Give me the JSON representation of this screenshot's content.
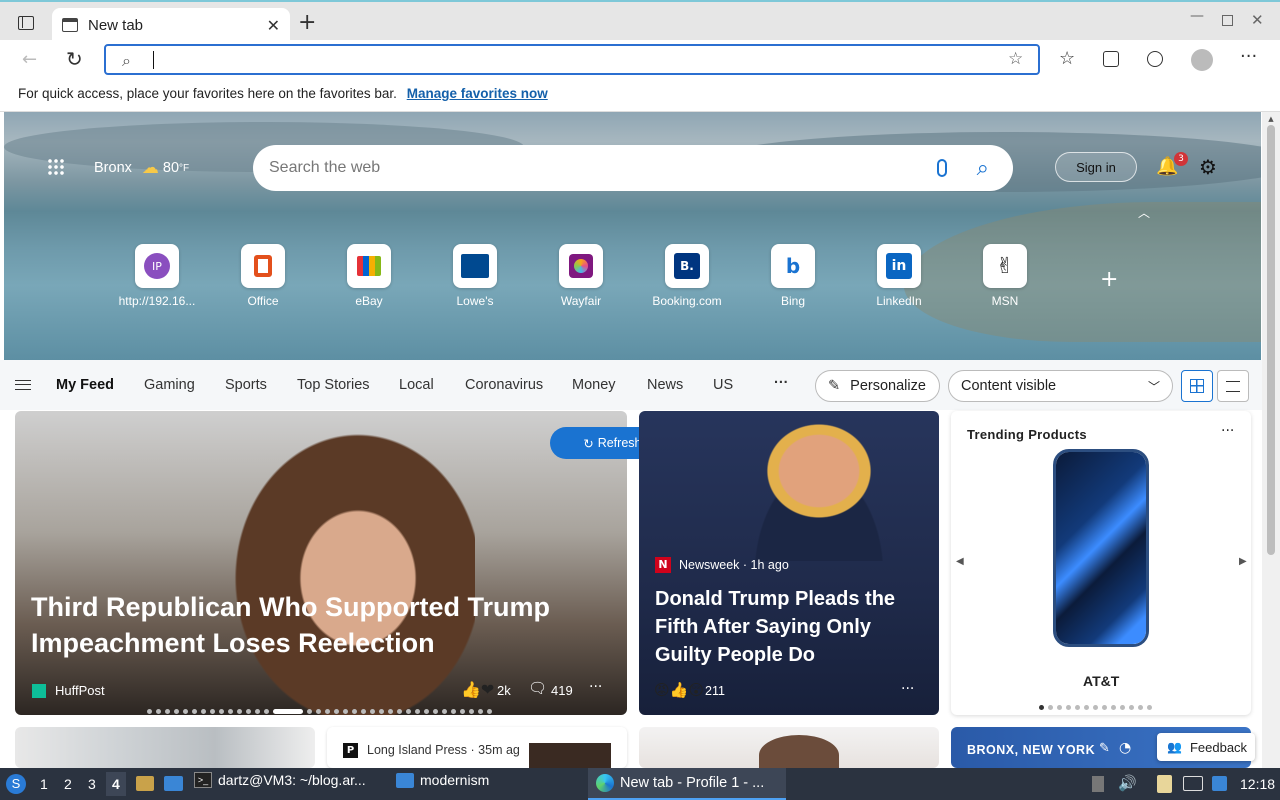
{
  "browser": {
    "tab_title": "New tab",
    "address_value": "",
    "favbar_text": "For quick access, place your favorites here on the favorites bar.",
    "favbar_link": "Manage favorites now"
  },
  "hero": {
    "location": "Bronx",
    "temp": "80",
    "unit": "°F",
    "search_placeholder": "Search the web",
    "sign_in": "Sign in",
    "notif_count": "3",
    "tiles": [
      {
        "label": "http://192.16...",
        "icon": "ip-icon"
      },
      {
        "label": "Office",
        "icon": "office-icon"
      },
      {
        "label": "eBay",
        "icon": "ebay-icon"
      },
      {
        "label": "Lowe's",
        "icon": "lowes-icon"
      },
      {
        "label": "Wayfair",
        "icon": "wayfair-icon"
      },
      {
        "label": "Booking.com",
        "icon": "booking-icon"
      },
      {
        "label": "Bing",
        "icon": "bing-icon"
      },
      {
        "label": "LinkedIn",
        "icon": "linkedin-icon"
      },
      {
        "label": "MSN",
        "icon": "msn-icon"
      }
    ],
    "ip_initials": "IP",
    "booking_letter": "B."
  },
  "feed": {
    "tabs": [
      "My Feed",
      "Gaming",
      "Sports",
      "Top Stories",
      "Local",
      "Coronavirus",
      "Money",
      "News",
      "US"
    ],
    "more": "···",
    "personalize": "Personalize",
    "content_visible": "Content visible",
    "refresh": "Refresh stories",
    "main_story": {
      "headline": "Third Republican Who Supported Trump Impeachment Loses Reelection",
      "source": "HuffPost",
      "reactions": "2k",
      "comments": "419"
    },
    "story2": {
      "source": "Newsweek · 1h ago",
      "headline": "Donald Trump Pleads the Fifth After Saying Only Guilty People Do",
      "reactions": "211"
    },
    "trending": {
      "title": "Trending Products",
      "product": "AT&T"
    },
    "row2_source": "Long Island Press · 35m ag",
    "weather_label": "BRONX, NEW YORK",
    "feedback": "Feedback"
  },
  "taskbar": {
    "workspaces": [
      "1",
      "2",
      "3",
      "4"
    ],
    "terminal": "dartz@VM3: ~/blog.ar...",
    "folder": "modernism",
    "browser": "New tab - Profile 1 - ...",
    "clock": "12:18"
  },
  "colors": {
    "accent": "#2b6fd1",
    "refresh_bg": "#1a73d1",
    "story2_bg": "#1f2a4a"
  }
}
